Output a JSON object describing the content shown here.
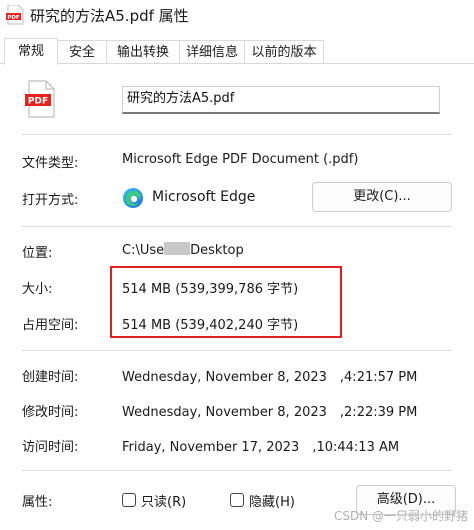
{
  "window": {
    "title": "研究的方法A5.pdf 属性",
    "icon_label": "PDF"
  },
  "tabs": [
    {
      "label": "常规",
      "active": true
    },
    {
      "label": "安全",
      "active": false
    },
    {
      "label": "输出转换",
      "active": false
    },
    {
      "label": "详细信息",
      "active": false
    },
    {
      "label": "以前的版本",
      "active": false
    }
  ],
  "general": {
    "file_icon_label": "PDF",
    "file_name": "研究的方法A5.pdf",
    "file_type_label": "文件类型:",
    "file_type_value": "Microsoft Edge PDF Document (.pdf)",
    "open_with_label": "打开方式:",
    "open_with_value": "Microsoft Edge",
    "change_button": "更改(C)...",
    "location_label": "位置:",
    "location_prefix": "C:\\Use",
    "location_suffix": "Desktop",
    "size_label": "大小:",
    "size_value": "514 MB (539,399,786 字节)",
    "size_on_disk_label": "占用空间:",
    "size_on_disk_value": "514 MB (539,402,240 字节)",
    "created_label": "创建时间:",
    "created_value": "Wednesday, November 8, 2023　,4:21:57 PM",
    "modified_label": "修改时间:",
    "modified_value": "Wednesday, November 8, 2023　,2:22:39 PM",
    "accessed_label": "访问时间:",
    "accessed_value": "Friday, November 17, 2023　,10:44:13 AM",
    "attributes_label": "属性:",
    "readonly_label": "只读(R)",
    "hidden_label": "隐藏(H)",
    "advanced_button": "高级(D)..."
  },
  "watermark": "CSDN @一只弱小的野猪",
  "colors": {
    "highlight_box": "#e02020",
    "pdf_red": "#e8231f"
  }
}
